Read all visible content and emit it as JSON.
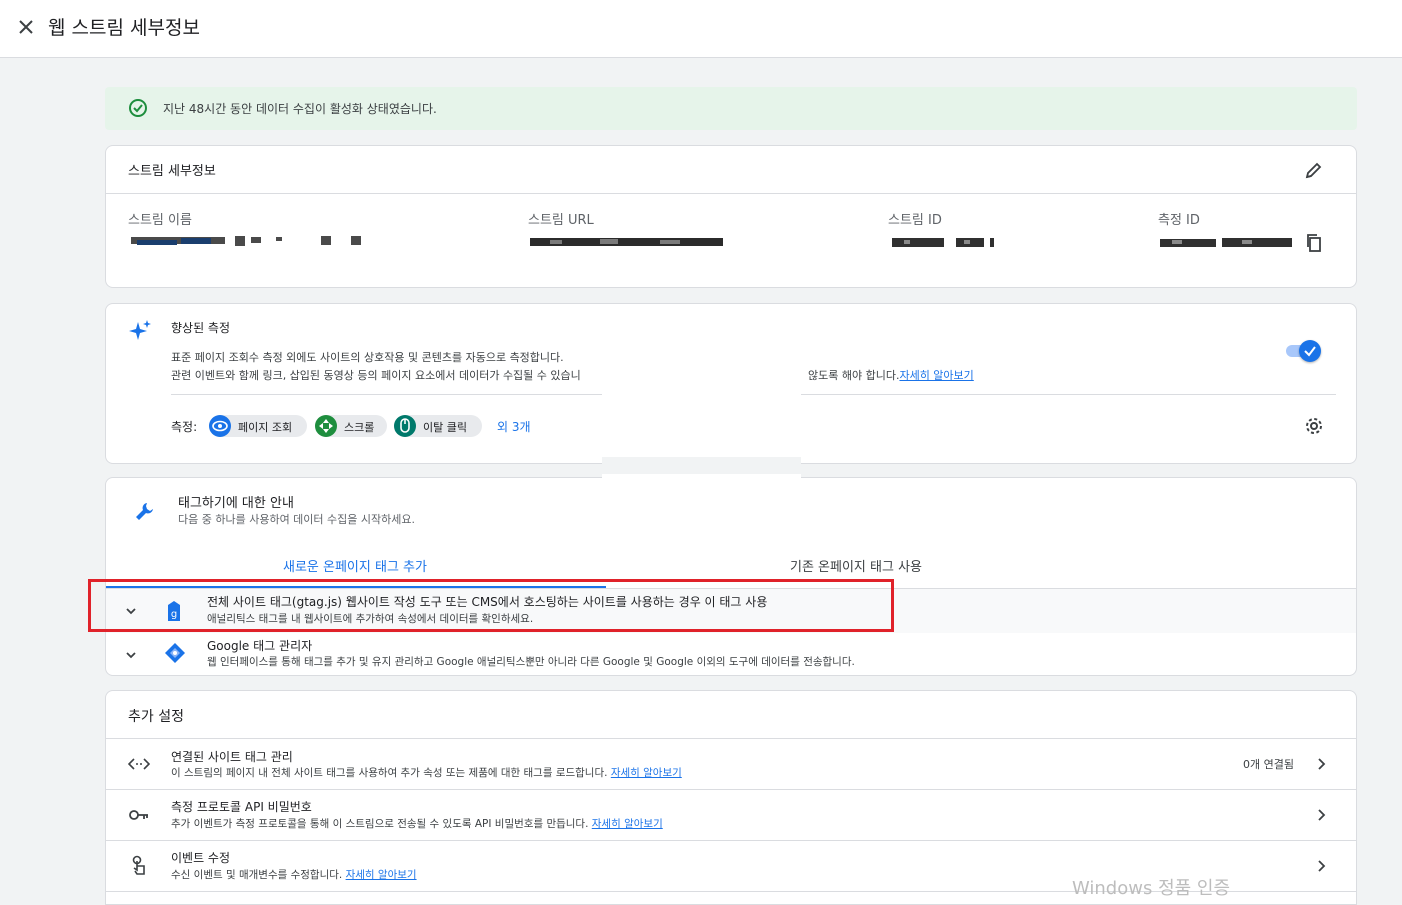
{
  "header": {
    "title": "웹 스트림 세부정보"
  },
  "banner": {
    "text": "지난 48시간 동안 데이터 수집이 활성화 상태였습니다."
  },
  "stream_details": {
    "title": "스트림 세부정보",
    "fields": [
      {
        "label": "스트림 이름"
      },
      {
        "label": "스트림 URL"
      },
      {
        "label": "스트림 ID"
      },
      {
        "label": "측정 ID"
      }
    ]
  },
  "enhanced": {
    "title": "향상된 측정",
    "desc_line1": "표준 페이지 조회수 측정 외에도 사이트의 상호작용 및 콘텐츠를 자동으로 측정합니다.",
    "desc_line2_a": "관련 이벤트와 함께 링크, 삽입된 동영상 등의 페이지 요소에서 데이터가 수집될 수 있습니",
    "desc_line2_b": "않도록 해야 합니다.",
    "learn_more": "자세히 알아보기",
    "toggle_on": true,
    "measure_label": "측정:",
    "chips": [
      {
        "label": "페이지 조회",
        "icon": "eye-icon",
        "color": "#1a73e8"
      },
      {
        "label": "스크롤",
        "icon": "scroll-icon",
        "color": "#1e8e3e"
      },
      {
        "label": "이탈 클릭",
        "icon": "mouse-icon",
        "color": "#00796b"
      }
    ],
    "more": "외 3개"
  },
  "tagging": {
    "title": "태그하기에 대한 안내",
    "subtitle": "다음 중 하나를 사용하여 데이터 수집을 시작하세요.",
    "tabs": [
      {
        "label": "새로운 온페이지 태그 추가",
        "active": true
      },
      {
        "label": "기존 온페이지 태그 사용",
        "active": false
      }
    ],
    "options": [
      {
        "title": "전체 사이트 태그(gtag.js) 웹사이트 작성 도구 또는 CMS에서 호스팅하는 사이트를 사용하는 경우 이 태그 사용",
        "desc": "애널리틱스 태그를 내 웹사이트에 추가하여 속성에서 데이터를 확인하세요.",
        "icon": "gtag-icon"
      },
      {
        "title": "Google 태그 관리자",
        "desc": "웹 인터페이스를 통해 태그를 추가 및 유지 관리하고 Google 애널리틱스뿐만 아니라 다른 Google 및 Google 이외의 도구에 데이터를 전송합니다.",
        "icon": "gtm-icon"
      }
    ]
  },
  "additional": {
    "title": "추가 설정",
    "rows": [
      {
        "title": "연결된 사이트 태그 관리",
        "desc": "이 스트림의 페이지 내 전체 사이트 태그를 사용하여 추가 속성 또는 제품에 대한 태그를 로드합니다.",
        "link": "자세히 알아보기",
        "badge": "0개 연결됨"
      },
      {
        "title": "측정 프로토콜 API 비밀번호",
        "desc": "추가 이벤트가 측정 프로토콜을 통해 이 스트림으로 전송될 수 있도록 API 비밀번호를 만듭니다.",
        "link": "자세히 알아보기"
      },
      {
        "title": "이벤트 수정",
        "desc": "수신 이벤트 및 매개변수를 수정합니다.",
        "link": "자세히 알아보기"
      }
    ]
  },
  "watermark": "Windows 정품 인증",
  "colors": {
    "accent": "#1a73e8",
    "highlight_box": "#e0222a",
    "banner_bg": "#e6f4ea",
    "success": "#1e8e3e"
  }
}
